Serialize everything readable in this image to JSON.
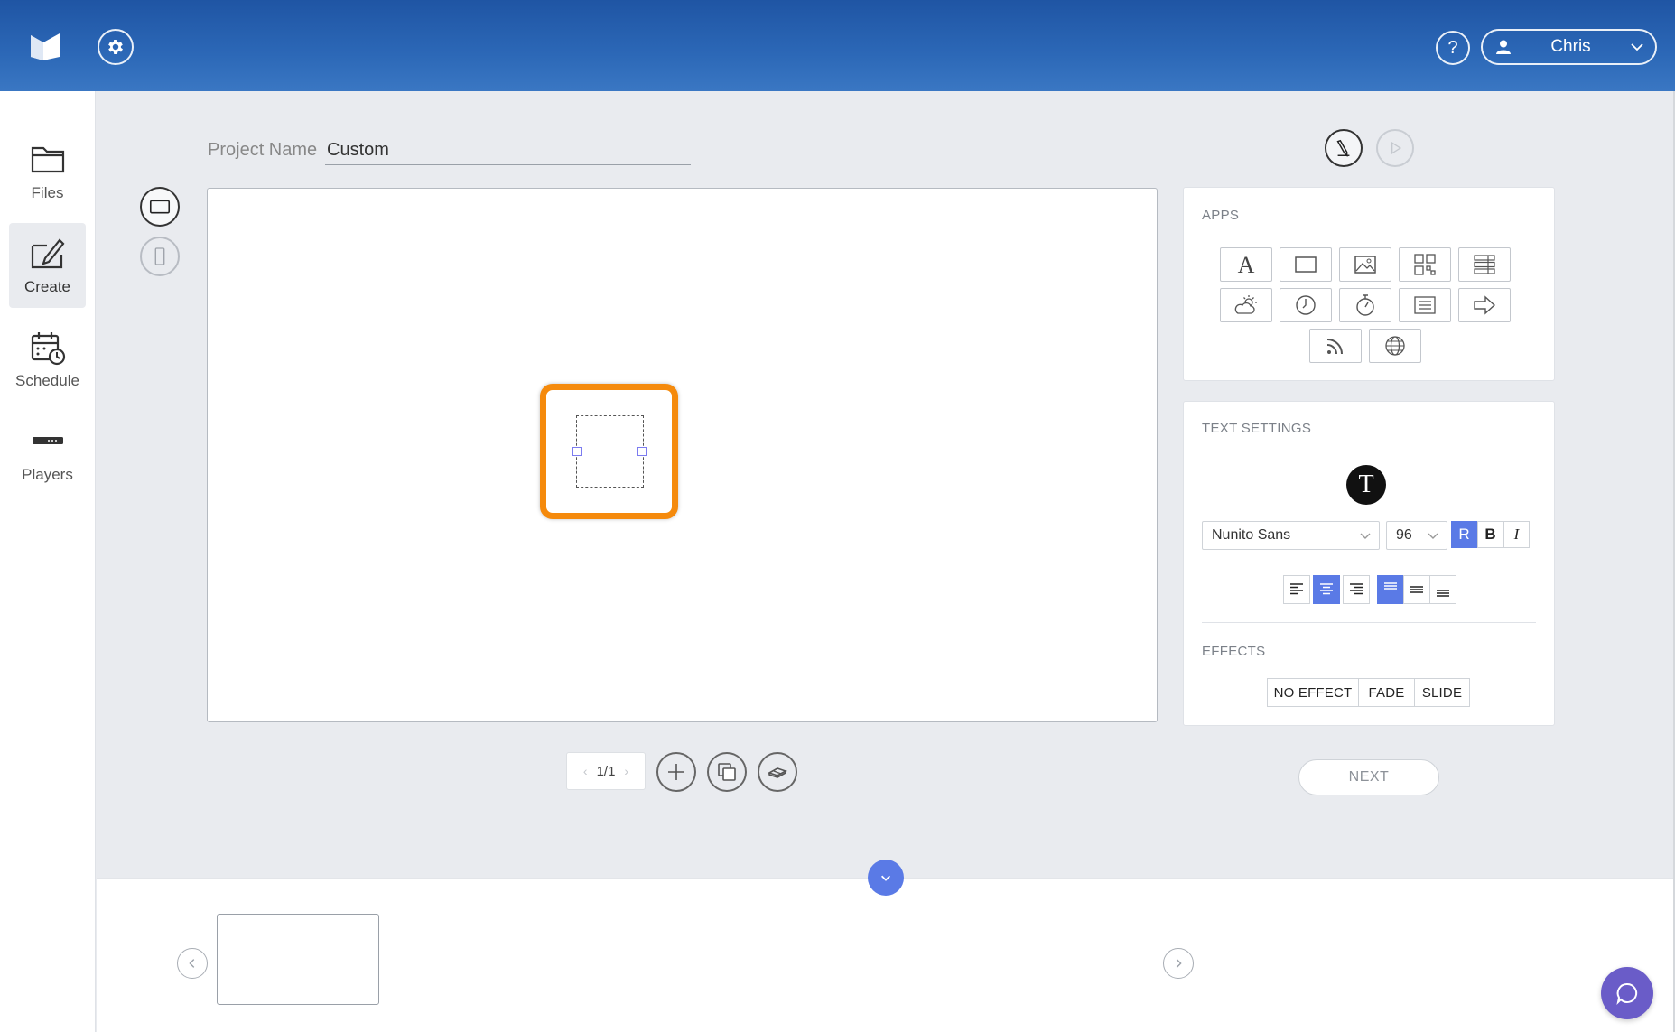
{
  "header": {
    "help_label": "?",
    "user_name": "Chris"
  },
  "sidebar": {
    "items": [
      {
        "label": "Files",
        "icon": "folder-icon"
      },
      {
        "label": "Create",
        "icon": "create-icon"
      },
      {
        "label": "Schedule",
        "icon": "calendar-clock-icon"
      },
      {
        "label": "Players",
        "icon": "player-device-icon"
      }
    ]
  },
  "project": {
    "name_label": "Project Name",
    "name_value": "Custom"
  },
  "pager": {
    "page_indicator": "1/1"
  },
  "apps_panel": {
    "title": "APPS",
    "apps": [
      "text-app-icon",
      "rectangle-app-icon",
      "image-app-icon",
      "qr-code-app-icon",
      "list-app-icon",
      "weather-app-icon",
      "clock-app-icon",
      "timer-app-icon",
      "ticker-app-icon",
      "arrow-app-icon",
      "rss-app-icon",
      "web-app-icon"
    ]
  },
  "text_settings": {
    "title": "TEXT SETTINGS",
    "avatar_letter": "T",
    "font_family": "Nunito Sans",
    "font_size": "96",
    "style_buttons": [
      "R",
      "B",
      "I"
    ],
    "active_style": "R",
    "active_horizontal_align": "center",
    "active_vertical_align": "top"
  },
  "effects": {
    "title": "EFFECTS",
    "options": [
      "NO EFFECT",
      "FADE",
      "SLIDE"
    ]
  },
  "next_label": "NEXT",
  "colors": {
    "header_blue": "#2c68b7",
    "accent": "#5a7ae6",
    "selection_orange": "#f58a0c",
    "chat_purple": "#6a5cc8"
  }
}
